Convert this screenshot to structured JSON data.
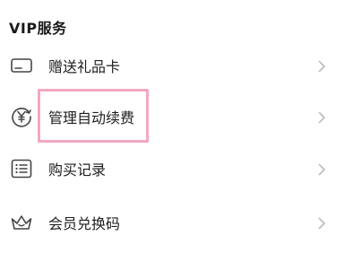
{
  "section": {
    "title": "VIP服务"
  },
  "items": [
    {
      "label": "赠送礼品卡",
      "icon": "gift-card-icon"
    },
    {
      "label": "管理自动续费",
      "icon": "yen-renew-icon"
    },
    {
      "label": "购买记录",
      "icon": "list-icon"
    },
    {
      "label": "会员兑换码",
      "icon": "crown-icon"
    }
  ],
  "colors": {
    "highlight": "#f2a7c3",
    "icon": "#444444",
    "chevron": "#b5b5b5"
  }
}
